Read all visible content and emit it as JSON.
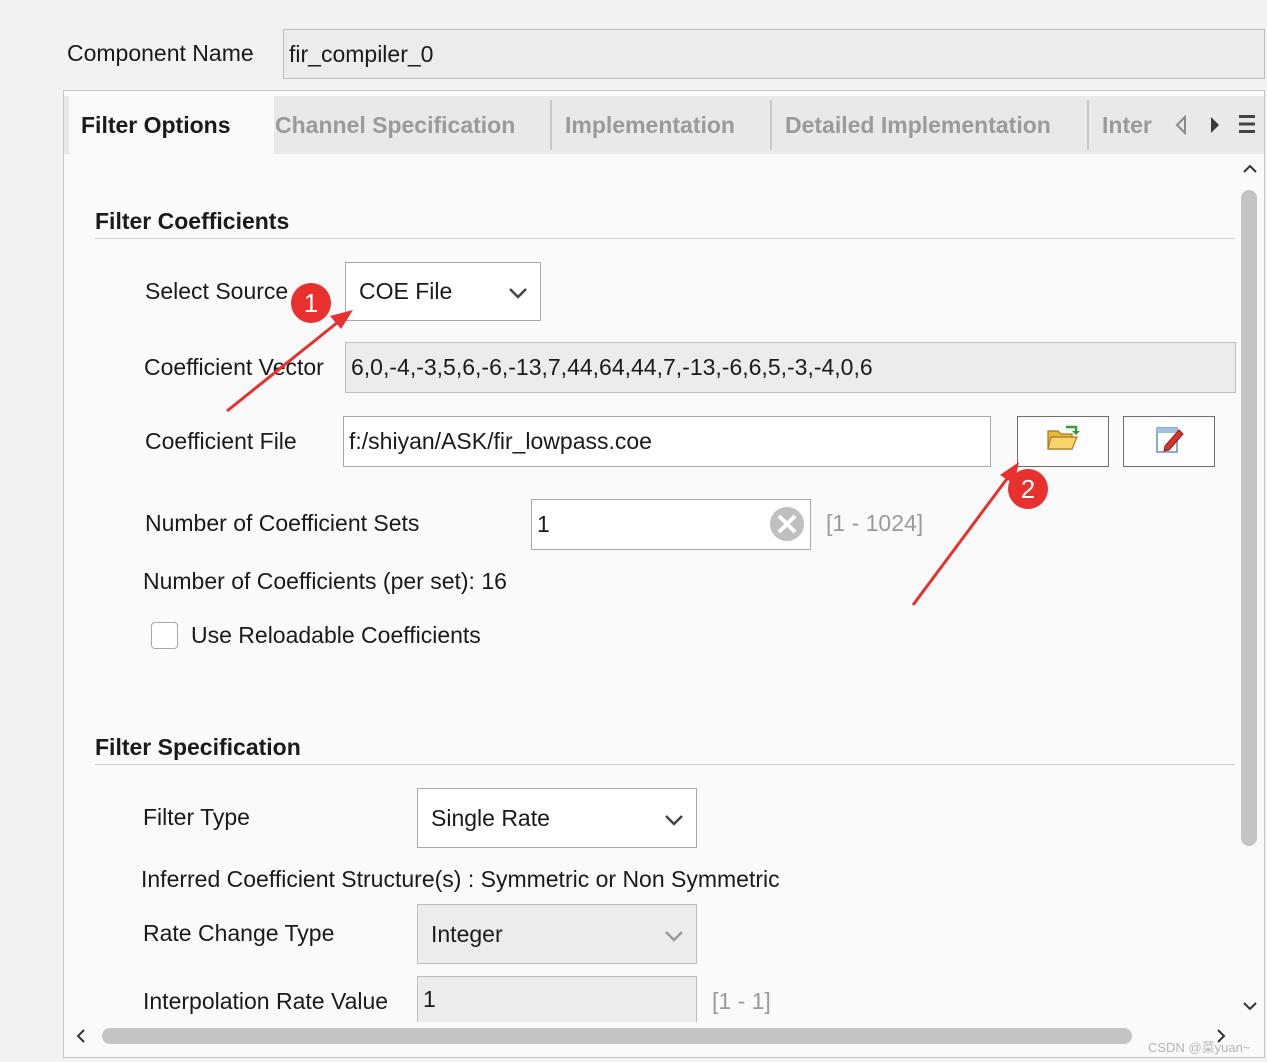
{
  "header": {
    "component_name_label": "Component Name",
    "component_name_value": "fir_compiler_0"
  },
  "tabs": [
    {
      "label": "Filter Options",
      "active": true
    },
    {
      "label": "Channel Specification",
      "active": false
    },
    {
      "label": "Implementation",
      "active": false
    },
    {
      "label": "Detailed Implementation",
      "active": false
    },
    {
      "label": "Inter",
      "active": false
    }
  ],
  "filter_coefficients": {
    "title": "Filter Coefficients",
    "select_source_label": "Select Source",
    "select_source_value": "COE File",
    "coefficient_vector_label": "Coefficient Vector",
    "coefficient_vector_value": "6,0,-4,-3,5,6,-6,-13,7,44,64,44,7,-13,-6,6,5,-3,-4,0,6",
    "coefficient_file_label": "Coefficient File",
    "coefficient_file_value": "f:/shiyan/ASK/fir_lowpass.coe",
    "num_sets_label": "Number of Coefficient Sets",
    "num_sets_value": "1",
    "num_sets_range": "[1 - 1024]",
    "num_coefficients_text": "Number of Coefficients (per set): 16",
    "reloadable_label": "Use Reloadable Coefficients",
    "reloadable_checked": false
  },
  "filter_specification": {
    "title": "Filter Specification",
    "filter_type_label": "Filter Type",
    "filter_type_value": "Single Rate",
    "inferred_text": "Inferred Coefficient Structure(s) : Symmetric or Non Symmetric",
    "rate_change_label": "Rate Change Type",
    "rate_change_value": "Integer",
    "interp_label": "Interpolation Rate Value",
    "interp_value": "1",
    "interp_range": "[1 - 1]"
  },
  "annotations": {
    "badge_1": "1",
    "badge_2": "2",
    "color": "#e8312f"
  },
  "watermark": "CSDN @菜yuan~",
  "icons": [
    "chevron-down-icon",
    "clear-icon",
    "open-folder-icon",
    "edit-file-icon",
    "tab-scroll-left-icon",
    "tab-scroll-right-icon",
    "tab-menu-icon",
    "scroll-up-icon",
    "scroll-down-icon",
    "scroll-left-icon",
    "scroll-right-icon"
  ]
}
